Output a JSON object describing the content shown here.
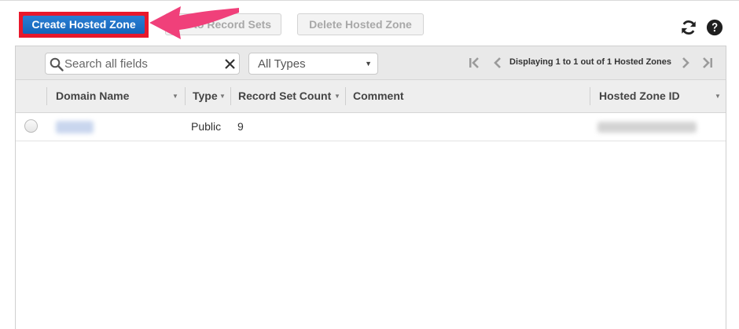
{
  "toolbar": {
    "create_label": "Create Hosted Zone",
    "go_label": "Go to Record Sets",
    "delete_label": "Delete Hosted Zone"
  },
  "filter": {
    "search_placeholder": "Search all fields",
    "type_selected": "All Types",
    "pager_text": "Displaying 1 to 1 out of 1 Hosted Zones"
  },
  "table": {
    "columns": [
      "Domain Name",
      "Type",
      "Record Set Count",
      "Comment",
      "Hosted Zone ID"
    ],
    "rows": [
      {
        "domain": "",
        "type": "Public",
        "record_set_count": "9",
        "comment": "",
        "zone_id": ""
      }
    ]
  },
  "icons": [
    "refresh-icon",
    "help-icon",
    "search-icon",
    "clear-icon",
    "first-page-icon",
    "prev-page-icon",
    "next-page-icon",
    "last-page-icon",
    "sort-icon",
    "callout-arrow"
  ],
  "colors": {
    "primary_button": "#1565b9",
    "highlight_border": "#e8182b",
    "callout_arrow": "#f0407a"
  }
}
